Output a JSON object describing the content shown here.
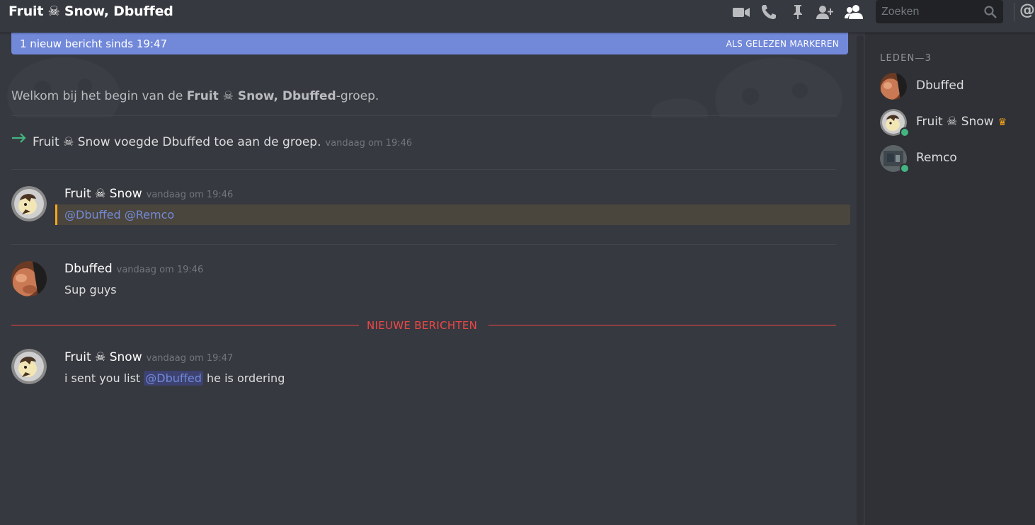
{
  "header": {
    "title": "Fruit ☠ Snow, Dbuffed",
    "search_placeholder": "Zoeken",
    "icons": [
      "video-icon",
      "phone-icon",
      "pin-icon",
      "add-member-icon",
      "members-icon",
      "search-icon",
      "mention-icon"
    ],
    "at_symbol": "@"
  },
  "banner": {
    "text": "1 nieuw bericht sinds 19:47",
    "mark_read": "ALS GELEZEN MARKEREN"
  },
  "welcome": {
    "prefix": "Welkom bij het begin van de ",
    "group": "Fruit ☠ Snow, Dbuffed",
    "suffix": "-groep."
  },
  "system_message": {
    "actor": "Fruit ☠ Snow",
    "verb": " voegde ",
    "target": "Dbuffed",
    "rest": " toe aan de groep.",
    "timestamp": "vandaag om 19:46"
  },
  "messages": [
    {
      "author": "Fruit ☠ Snow",
      "timestamp": "vandaag om 19:46",
      "mention1": "@Dbuffed",
      "mention2": "@Remco"
    },
    {
      "author": "Dbuffed",
      "timestamp": "vandaag om 19:46",
      "text": "Sup guys"
    },
    {
      "author": "Fruit ☠ Snow",
      "timestamp": "vandaag om 19:47",
      "text_before": "i sent you list ",
      "mention": "@Dbuffed",
      "text_after": " he is ordering"
    }
  ],
  "new_messages_label": "NIEUWE BERICHTEN",
  "members": {
    "header": "LEDEN—3",
    "list": [
      {
        "name": "Dbuffed",
        "online": false,
        "owner": false
      },
      {
        "name": "Fruit ☠ Snow",
        "online": true,
        "owner": true
      },
      {
        "name": "Remco",
        "online": true,
        "owner": false
      }
    ]
  },
  "colors": {
    "background": "#36393f",
    "sidebar": "#2f3136",
    "accent": "#7289da",
    "mention_highlight": "#faa61a",
    "new_messages": "#f04747",
    "online": "#43b581"
  }
}
